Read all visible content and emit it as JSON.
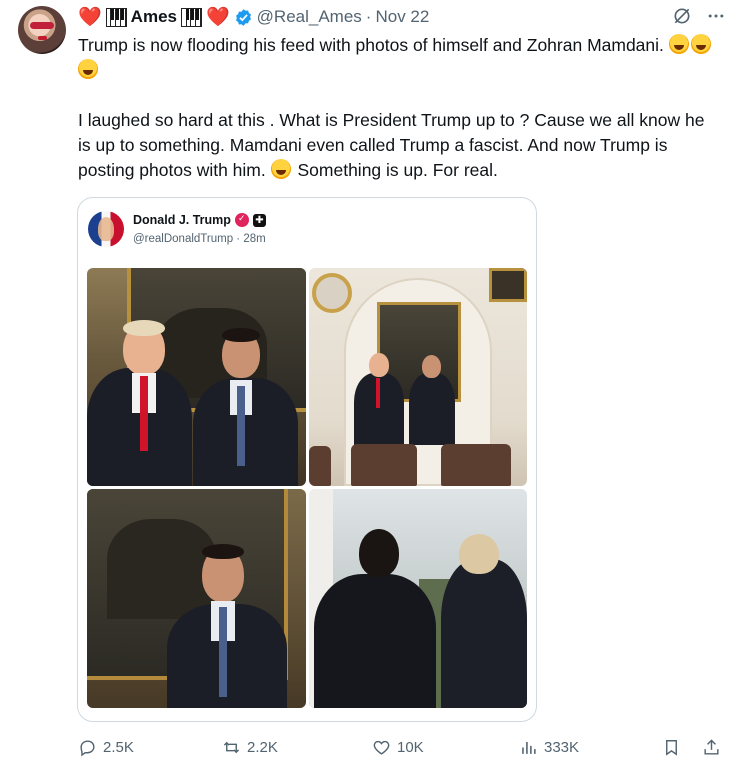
{
  "tweet": {
    "author": {
      "name": "Ames",
      "handle": "@Real_Ames",
      "separator": "·",
      "date": "Nov 22",
      "prefix_heart": "❤️",
      "suffix_heart": "❤️"
    },
    "paragraphs": [
      "Trump is now flooding his feed with photos of himself and Zohran Mamdani.",
      "I laughed so hard at this .  What is President Trump up to ? Cause we all know he is up to something.    Mamdani  even called Trump a fascist.     And now Trump is posting photos with him.",
      "Something is up.   For real."
    ],
    "quoted": {
      "name": "Donald J. Trump",
      "handle": "@realDonaldTrump",
      "separator": "·",
      "time": "28m"
    },
    "stats": {
      "replies": "2.5K",
      "reposts": "2.2K",
      "likes": "10K",
      "views": "333K"
    },
    "icons": [
      "grok-icon",
      "more-icon",
      "reply-icon",
      "repost-icon",
      "like-icon",
      "views-icon",
      "bookmark-icon",
      "share-icon"
    ],
    "colors": {
      "accent": "#1d9bf0",
      "secondary_text": "#536471",
      "heart": "#e0245e"
    }
  }
}
